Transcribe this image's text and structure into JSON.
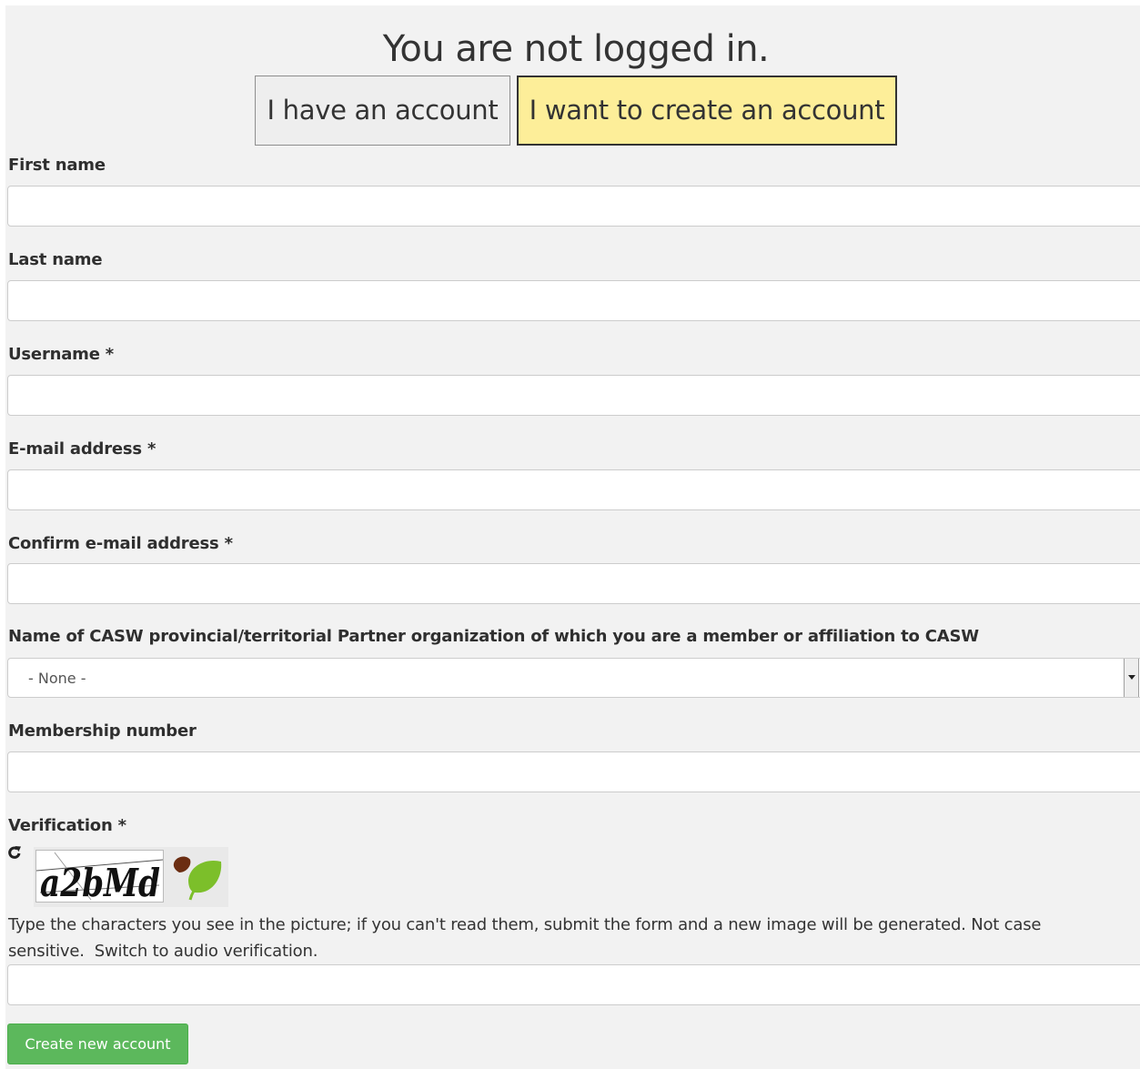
{
  "header": {
    "title": "You are not logged in.",
    "have_account_label": "I have an account",
    "create_account_label": "I want to create an account"
  },
  "form": {
    "first_name": {
      "label": "First name",
      "value": ""
    },
    "last_name": {
      "label": "Last name",
      "value": ""
    },
    "username": {
      "label": "Username *",
      "value": ""
    },
    "email": {
      "label": "E-mail address *",
      "value": ""
    },
    "confirm_email": {
      "label": "Confirm e-mail address *",
      "value": ""
    },
    "partner_org": {
      "label": "Name of CASW provincial/territorial Partner organization of which you are a member or affiliation to CASW",
      "selected": "- None -"
    },
    "membership_number": {
      "label": "Membership number",
      "value": ""
    },
    "verification": {
      "label": "Verification *",
      "captcha_text": "a2bMd",
      "help_text": "Type the characters you see in the picture; if you can't read them, submit the form and a new image will be generated. Not case sensitive.",
      "audio_link": "Switch to audio verification.",
      "value": ""
    },
    "submit_label": "Create new account"
  },
  "colors": {
    "active_toggle": "#fdee99",
    "submit_green": "#5cb85c",
    "page_background": "#f2f2f2"
  },
  "icons": {
    "refresh": "refresh-icon",
    "captcha_logo": "leaf-logo"
  }
}
